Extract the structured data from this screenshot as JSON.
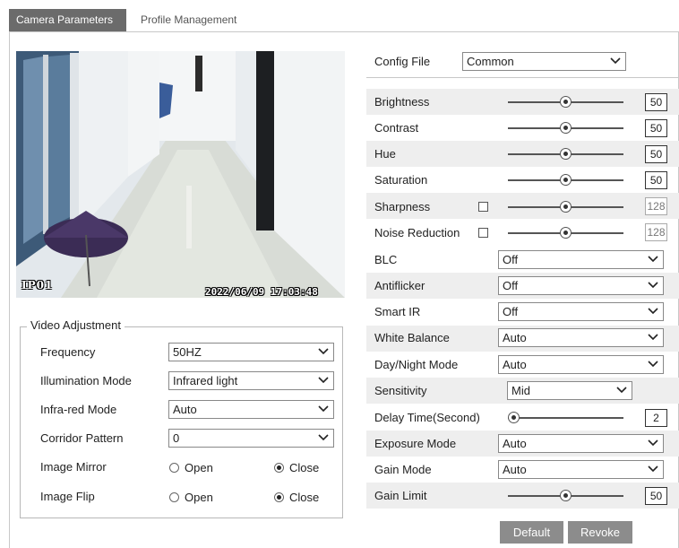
{
  "tabs": [
    {
      "label": "Camera Parameters",
      "active": true
    },
    {
      "label": "Profile Management",
      "active": false
    }
  ],
  "video": {
    "channel_label": "IP01",
    "timestamp": "2022/06/09 17:03:48"
  },
  "video_adjustment": {
    "title": "Video Adjustment",
    "frequency": {
      "label": "Frequency",
      "value": "50HZ"
    },
    "illumination_mode": {
      "label": "Illumination Mode",
      "value": "Infrared light"
    },
    "infrared_mode": {
      "label": "Infra-red Mode",
      "value": "Auto"
    },
    "corridor_pattern": {
      "label": "Corridor Pattern",
      "value": "0"
    },
    "image_mirror": {
      "label": "Image Mirror",
      "open_label": "Open",
      "close_label": "Close",
      "selected": "Close"
    },
    "image_flip": {
      "label": "Image Flip",
      "open_label": "Open",
      "close_label": "Close",
      "selected": "Close"
    }
  },
  "config_file": {
    "label": "Config File",
    "value": "Common"
  },
  "brightness": {
    "label": "Brightness",
    "value": "50"
  },
  "contrast": {
    "label": "Contrast",
    "value": "50"
  },
  "hue": {
    "label": "Hue",
    "value": "50"
  },
  "saturation": {
    "label": "Saturation",
    "value": "50"
  },
  "sharpness": {
    "label": "Sharpness",
    "value": "128",
    "enabled": false
  },
  "noise_reduction": {
    "label": "Noise Reduction",
    "value": "128",
    "enabled": false
  },
  "blc": {
    "label": "BLC",
    "value": "Off"
  },
  "antiflicker": {
    "label": "Antiflicker",
    "value": "Off"
  },
  "smart_ir": {
    "label": "Smart IR",
    "value": "Off"
  },
  "white_balance": {
    "label": "White Balance",
    "value": "Auto"
  },
  "day_night_mode": {
    "label": "Day/Night Mode",
    "value": "Auto"
  },
  "sensitivity": {
    "label": "Sensitivity",
    "value": "Mid"
  },
  "delay_time": {
    "label": "Delay Time(Second)",
    "value": "2"
  },
  "exposure_mode": {
    "label": "Exposure Mode",
    "value": "Auto"
  },
  "gain_mode": {
    "label": "Gain Mode",
    "value": "Auto"
  },
  "gain_limit": {
    "label": "Gain Limit",
    "value": "50"
  },
  "buttons": {
    "default_label": "Default",
    "revoke_label": "Revoke"
  },
  "colors": {
    "tab_active": "#6b6b6b",
    "button": "#8c8c8c",
    "stripe": "#eeeeee"
  },
  "icons": {
    "dropdown": "chevron-down-icon",
    "radio": "radio-icon",
    "checkbox": "checkbox-icon"
  }
}
